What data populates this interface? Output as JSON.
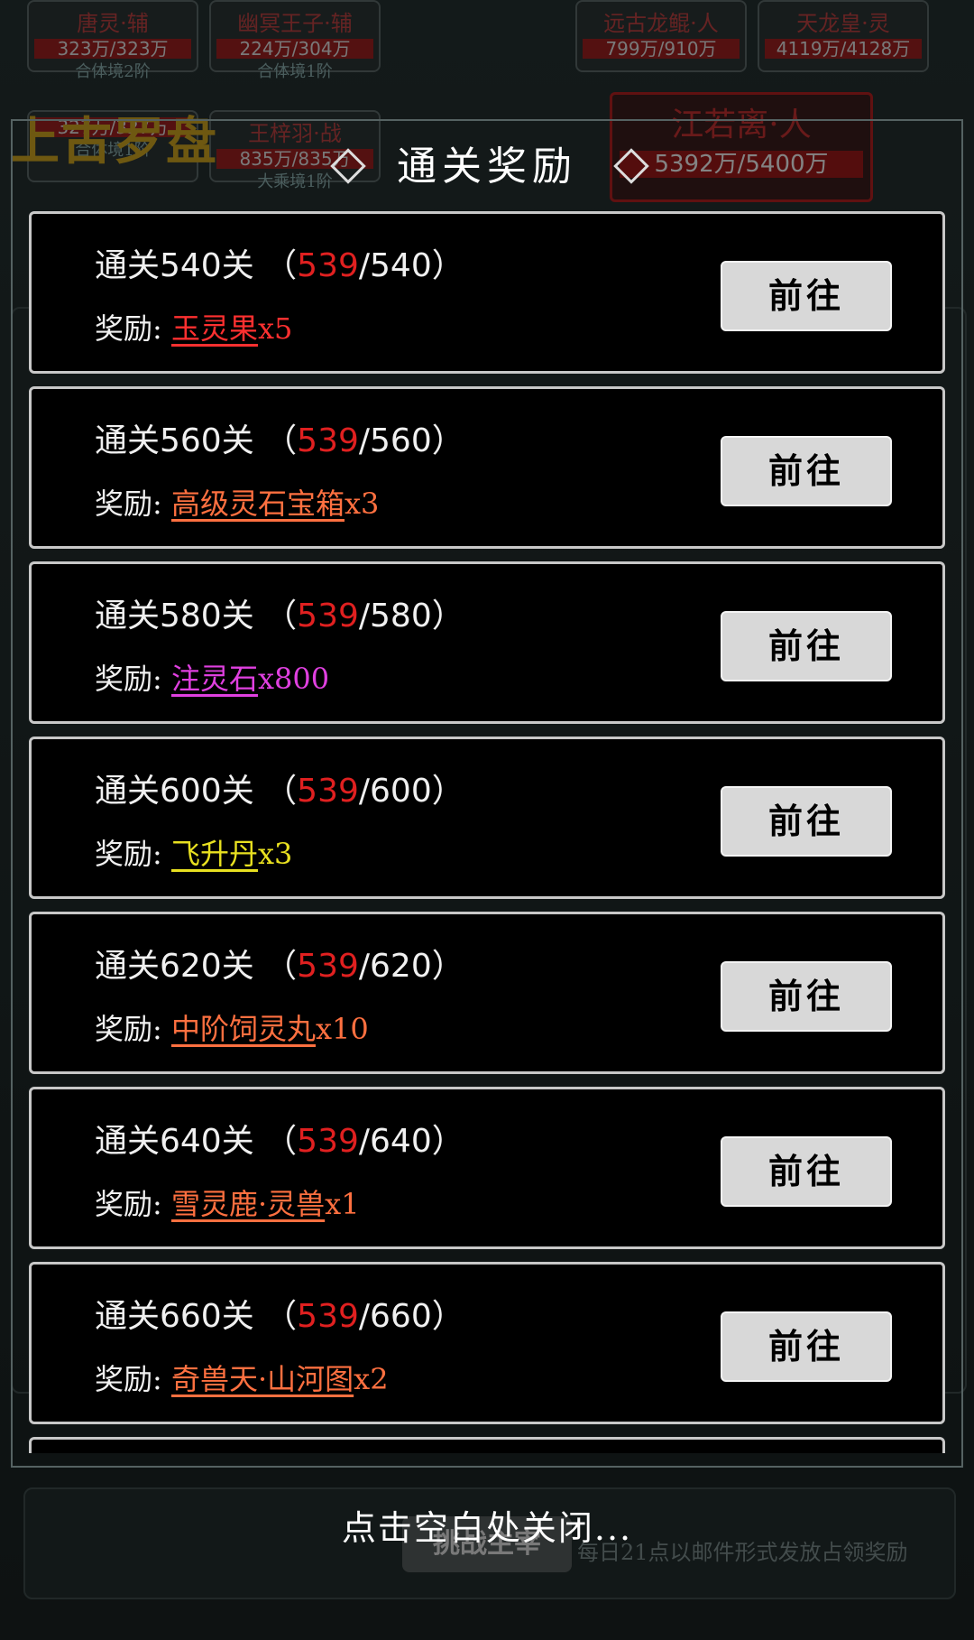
{
  "background": {
    "title": "上古罗盘",
    "allies": [
      {
        "name": "唐灵·辅",
        "hp": "323万/323万",
        "realm": "合体境2阶"
      },
      {
        "name": "幽冥王子·辅",
        "hp": "224万/304万",
        "realm": "合体境1阶"
      },
      {
        "name": "",
        "hp": "327万/327万",
        "realm": "合体境1阶"
      },
      {
        "name": "王梓羽·战",
        "hp": "835万/835万",
        "realm": "大乘境1阶"
      }
    ],
    "enemies": [
      {
        "name": "远古龙鲲·人",
        "hp": "799万/910万"
      },
      {
        "name": "天龙皇·灵",
        "hp": "4119万/4128万"
      }
    ],
    "boss": {
      "name": "江若离·人",
      "hp": "5392万/5400万"
    },
    "challenge_button": "挑战主宰",
    "daily_note": "每日21点以邮件形式发放占领奖励"
  },
  "dialog": {
    "title": "通关奖励",
    "reward_prefix": "奖励:",
    "go_label": "前往",
    "close_hint": "点击空白处关闭...",
    "rewards": [
      {
        "stage": "通关540关 （",
        "current": "539",
        "target": "/540）",
        "item": "玉灵果",
        "qty": "x5",
        "color": "#ff3030"
      },
      {
        "stage": "通关560关 （",
        "current": "539",
        "target": "/560）",
        "item": "高级灵石宝箱",
        "qty": "x3",
        "color": "#ff7040"
      },
      {
        "stage": "通关580关 （",
        "current": "539",
        "target": "/580）",
        "item": "注灵石",
        "qty": "x800",
        "color": "#e040e0"
      },
      {
        "stage": "通关600关 （",
        "current": "539",
        "target": "/600）",
        "item": "飞升丹",
        "qty": "x3",
        "color": "#e8e020"
      },
      {
        "stage": "通关620关 （",
        "current": "539",
        "target": "/620）",
        "item": "中阶饲灵丸",
        "qty": "x10",
        "color": "#ff7040"
      },
      {
        "stage": "通关640关 （",
        "current": "539",
        "target": "/640）",
        "item": "雪灵鹿·灵兽",
        "qty": "x1",
        "color": "#ff7040"
      },
      {
        "stage": "通关660关 （",
        "current": "539",
        "target": "/660）",
        "item": "奇兽天·山河图",
        "qty": "x2",
        "color": "#ff7040"
      }
    ]
  }
}
